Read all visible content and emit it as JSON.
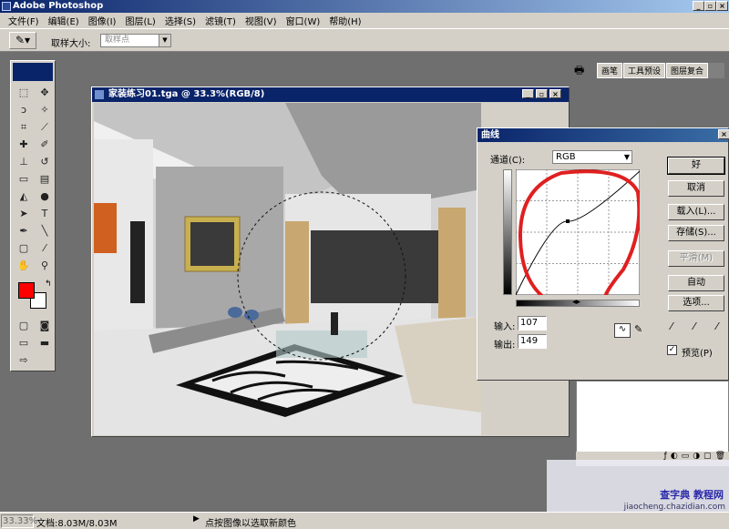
{
  "app": {
    "title": "Adobe Photoshop"
  },
  "menu": [
    "文件(F)",
    "编辑(E)",
    "图像(I)",
    "图层(L)",
    "选择(S)",
    "滤镜(T)",
    "视图(V)",
    "窗口(W)",
    "帮助(H)"
  ],
  "options": {
    "sample_size_label": "取样大小:",
    "sample_size_value": "取样点"
  },
  "palette_well": [
    "画笔",
    "工具预设",
    "图层复合"
  ],
  "document": {
    "title": "家装练习01.tga @ 33.3%(RGB/8)"
  },
  "curves": {
    "title": "曲线",
    "channel_label": "通道(C):",
    "channel_value": "RGB",
    "buttons": {
      "ok": "好",
      "cancel": "取消",
      "load": "载入(L)...",
      "save": "存储(S)...",
      "smooth": "平滑(M)",
      "auto": "自动",
      "options": "选项..."
    },
    "input_label": "输入:",
    "input_value": "107",
    "output_label": "输出:",
    "output_value": "149",
    "preview_label": "预览(P)",
    "preview_checked": true
  },
  "status": {
    "zoom": "33.33%",
    "doc_info": "文档:8.03M/8.03M",
    "hint": "点按图像以选取新颜色"
  },
  "watermark": {
    "line1": "查字典 教程网",
    "line2": "jiaocheng.chazidian.com"
  },
  "colors": {
    "foreground": "#ff0000",
    "background": "#ffffff",
    "title_blue": "#0a246a",
    "annotation_red": "#e02020"
  }
}
